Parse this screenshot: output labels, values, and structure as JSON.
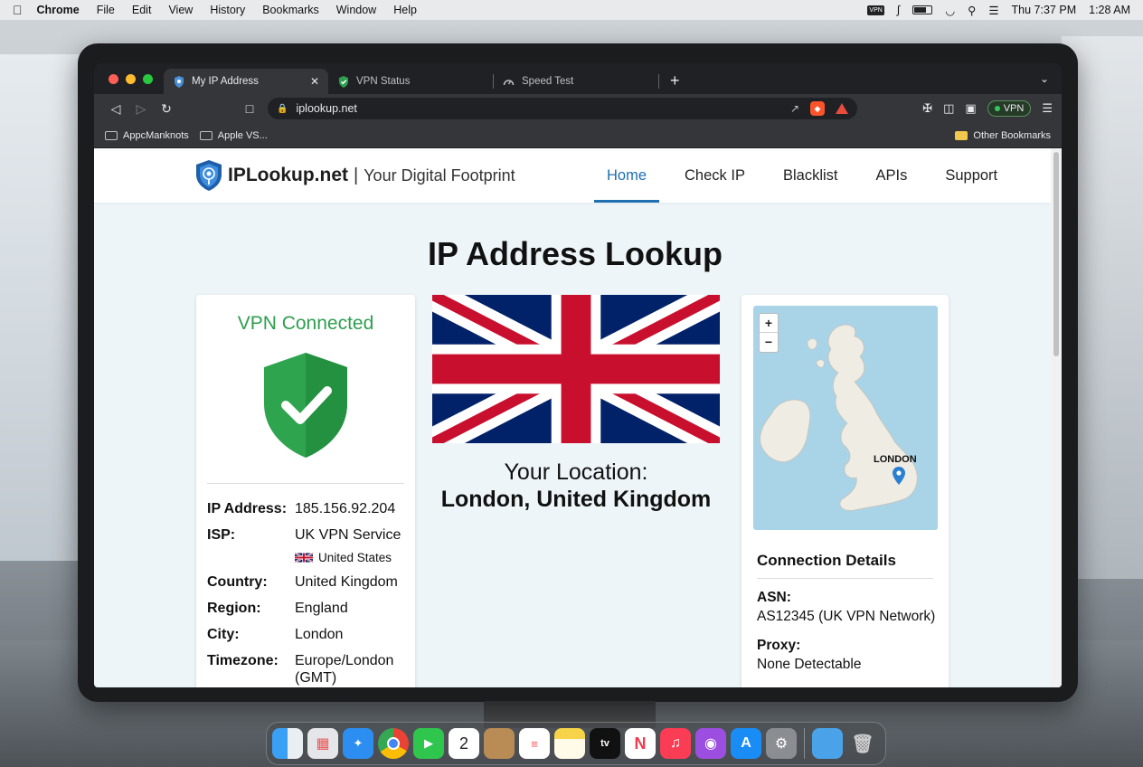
{
  "menubar": {
    "app": "Chrome",
    "items": [
      "File",
      "Edit",
      "View",
      "History",
      "Bookmarks",
      "Window",
      "Help"
    ],
    "vpn_badge": "VPN",
    "clock": "Thu 7:37 PM",
    "time2": "1:28 AM"
  },
  "browser": {
    "tabs": [
      {
        "label": "My IP Address",
        "active": true,
        "icon": "shield-icon"
      },
      {
        "label": "VPN Status",
        "active": false,
        "icon": "green-shield-icon"
      },
      {
        "label": "Speed Test",
        "active": false,
        "icon": "gauge-icon"
      }
    ],
    "url": "iplookup.net",
    "vpn_pill": "VPN",
    "bookmarks": [
      "AppcManknots",
      "Apple VS..."
    ],
    "other_bookmarks": "Other Bookmarks"
  },
  "site": {
    "logo_name": "IPLookup.net",
    "logo_sep": "|",
    "tagline": "Your Digital Footprint",
    "nav": [
      "Home",
      "Check IP",
      "Blacklist",
      "APIs",
      "Support"
    ],
    "page_title": "IP Address Lookup"
  },
  "status_card": {
    "title": "VPN Connected",
    "rows": {
      "ip_k": "IP Address:",
      "ip_v": "185.156.92.204",
      "isp_k": "ISP:",
      "isp_v": "UK VPN Service",
      "isp_sub": "United States",
      "country_k": "Country:",
      "country_v": "United Kingdom",
      "region_k": "Region:",
      "region_v": "England",
      "city_k": "City:",
      "city_v": "London",
      "tz_k": "Timezone:",
      "tz_v": "Europe/London (GMT)"
    }
  },
  "location": {
    "label": "Your Location:",
    "value": "London, United Kingdom"
  },
  "map": {
    "zoom_in": "+",
    "zoom_out": "−",
    "marker_label": "LONDON"
  },
  "connection": {
    "title": "Connection Details",
    "asn_k": "ASN:",
    "asn_v": "AS12345 (UK VPN Network)",
    "proxy_k": "Proxy:",
    "proxy_v": "None Detectable"
  },
  "colors": {
    "accent": "#1f6fb2",
    "vpn_green": "#2e9e4f",
    "flag_blue": "#012169",
    "flag_red": "#C8102E"
  }
}
